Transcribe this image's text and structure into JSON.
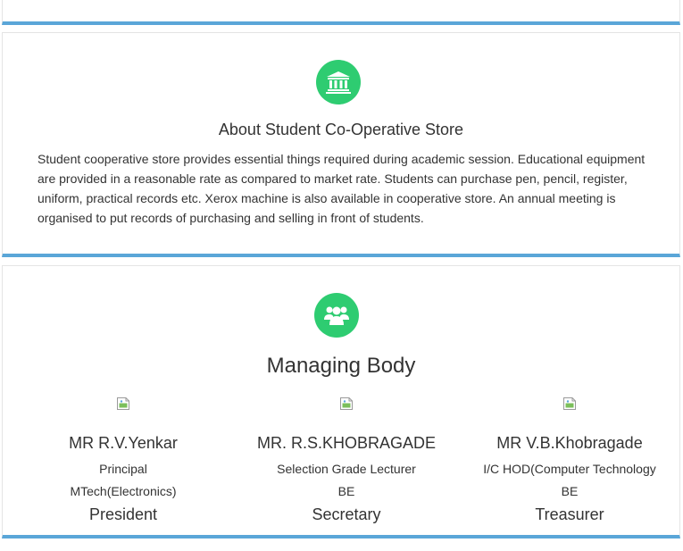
{
  "about": {
    "title": "About Student Co-Operative Store",
    "icon": "bank-icon",
    "description": "Student cooperative store provides essential things required during academic session. Educational equipment are provided in a reasonable rate as compared to market rate. Students can purchase pen, pencil, register, uniform, practical records etc. Xerox machine is also available in cooperative store. An annual meeting is organised to put records of purchasing and selling in front of students."
  },
  "managing_body": {
    "title": "Managing Body",
    "icon": "users-icon",
    "members": [
      {
        "name": "MR R.V.Yenkar",
        "designation": "Principal",
        "qualification": "MTech(Electronics)",
        "role": "President"
      },
      {
        "name": "MR. R.S.KHOBRAGADE",
        "designation": "Selection Grade Lecturer",
        "qualification": "BE",
        "role": "Secretary"
      },
      {
        "name": "MR V.B.Khobragade",
        "designation": "I/C HOD(Computer Technology",
        "qualification": "BE",
        "role": "Treasurer"
      }
    ]
  },
  "colors": {
    "accent_bar": "#5aa6d8",
    "icon_circle": "#2ecc71",
    "text": "#333333"
  }
}
